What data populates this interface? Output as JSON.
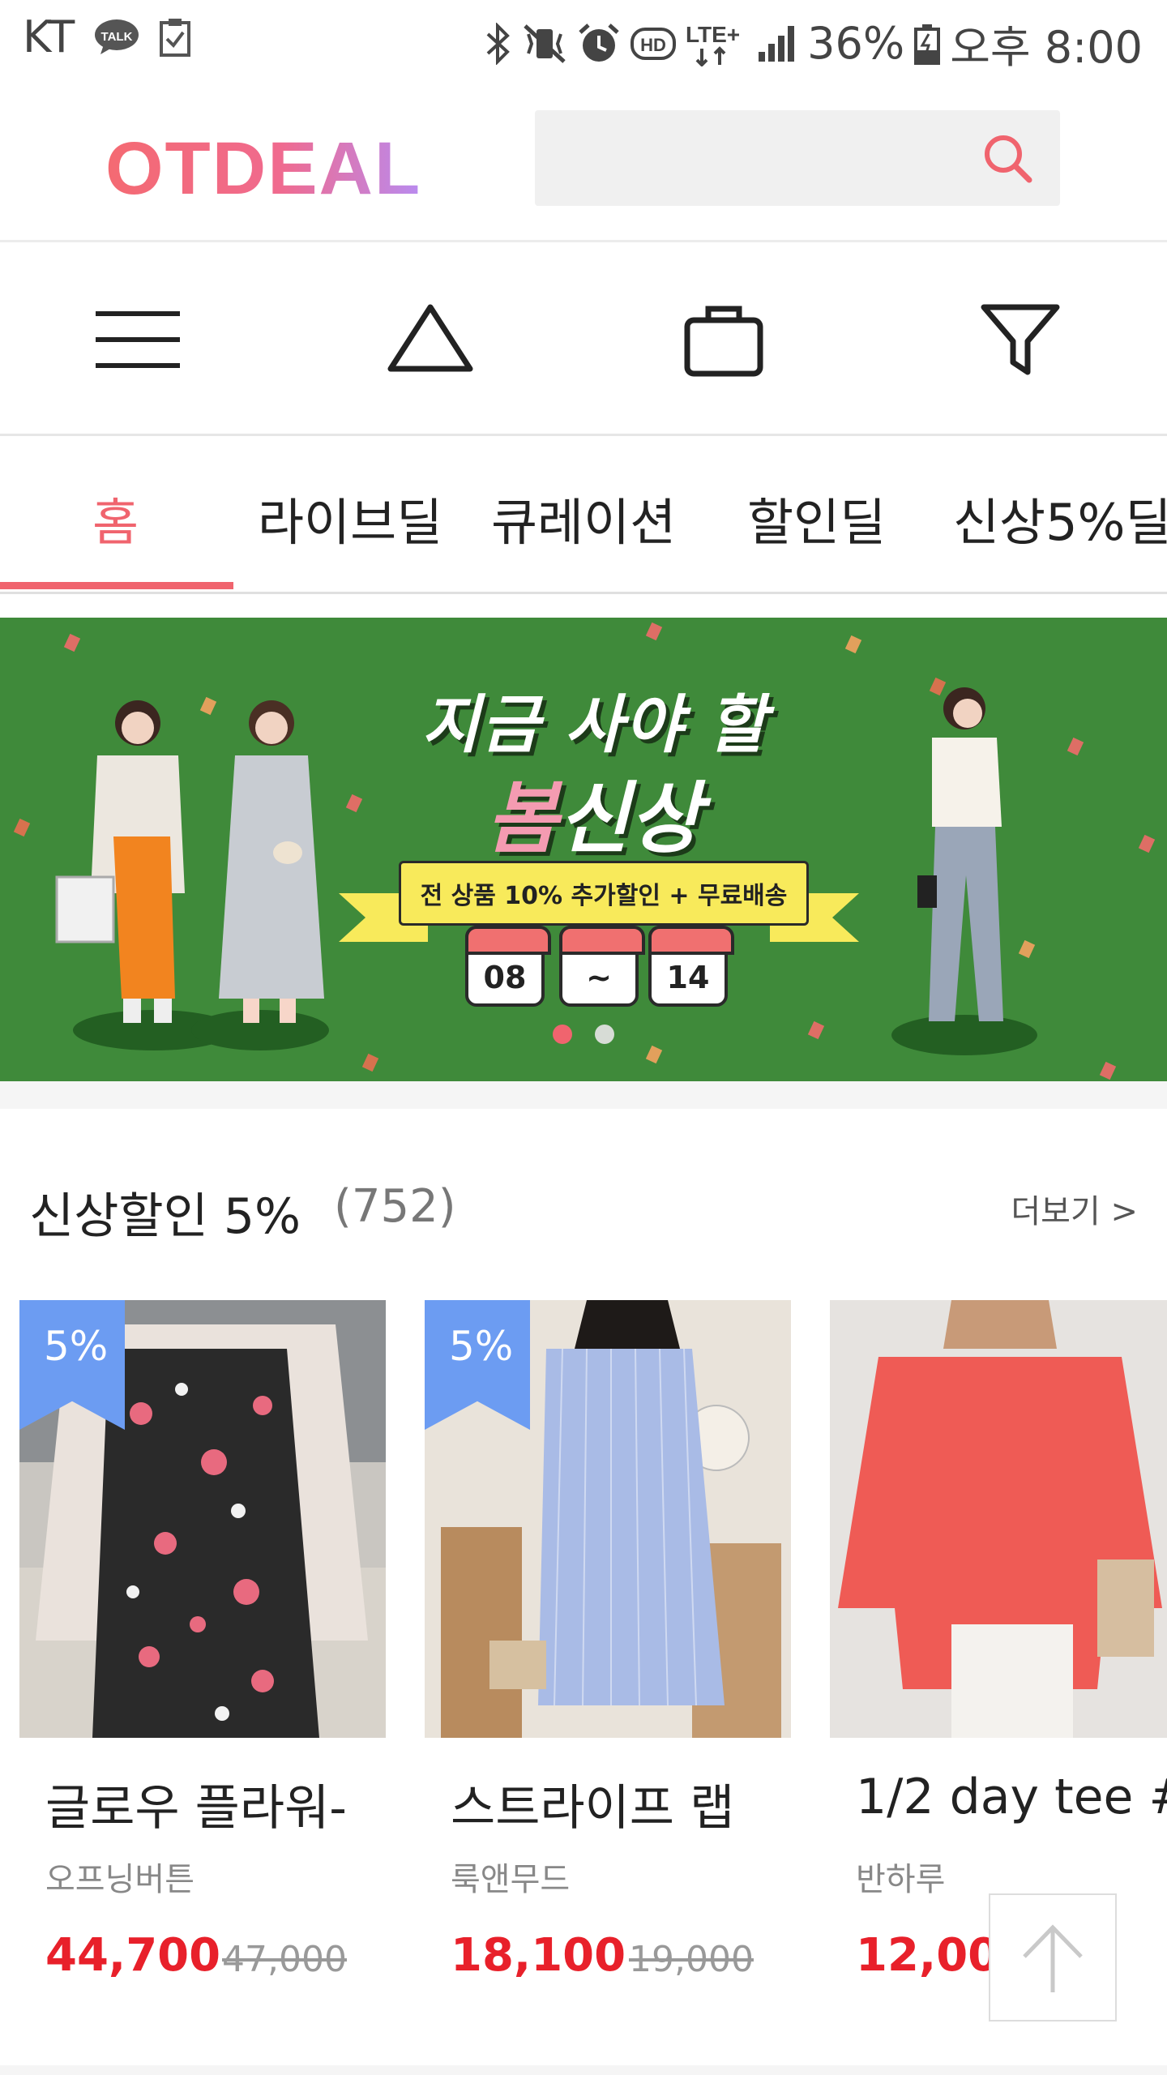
{
  "status_bar": {
    "carrier": "KT",
    "talk_badge": "TALK",
    "network": "LTE+",
    "hd": "HD",
    "battery": "36%",
    "time": "오후 8:00"
  },
  "header": {
    "logo": "OTDEAL",
    "search_placeholder": ""
  },
  "toolbar": {
    "icons": [
      "menu-icon",
      "hanger-icon",
      "bag-icon",
      "filter-icon"
    ]
  },
  "tabs": [
    {
      "label": "홈",
      "active": true
    },
    {
      "label": "라이브딜"
    },
    {
      "label": "큐레이션"
    },
    {
      "label": "할인딜"
    },
    {
      "label": "신상5%딜"
    }
  ],
  "banner": {
    "title_line1": "지금 사야 할",
    "title_line2_pink": "봄",
    "title_line2_rest": "신상",
    "ribbon_text": "전 상품 10% 추가할인 + 무료배송",
    "date_start": "08",
    "date_sep": "~",
    "date_end": "14",
    "slide_count": 2,
    "active_slide": 1
  },
  "section": {
    "title": "신상할인 5%",
    "count": "(752)",
    "more": "더보기 >"
  },
  "products": [
    {
      "badge": "5%",
      "name": "글로우 플라워-",
      "brand": "오프닝버튼",
      "price": "44,700",
      "original": "47,000"
    },
    {
      "badge": "5%",
      "name": "스트라이프 랩",
      "brand": "룩앤무드",
      "price": "18,100",
      "original": "19,000"
    },
    {
      "badge": "",
      "name": "1/2 day tee #",
      "brand": "반하루",
      "price": "12,000",
      "original": ""
    }
  ],
  "colors": {
    "accent": "#f0646e",
    "price_red": "#e8202a",
    "badge_blue": "#6c9cf2",
    "banner_green": "#3f8a3a"
  }
}
